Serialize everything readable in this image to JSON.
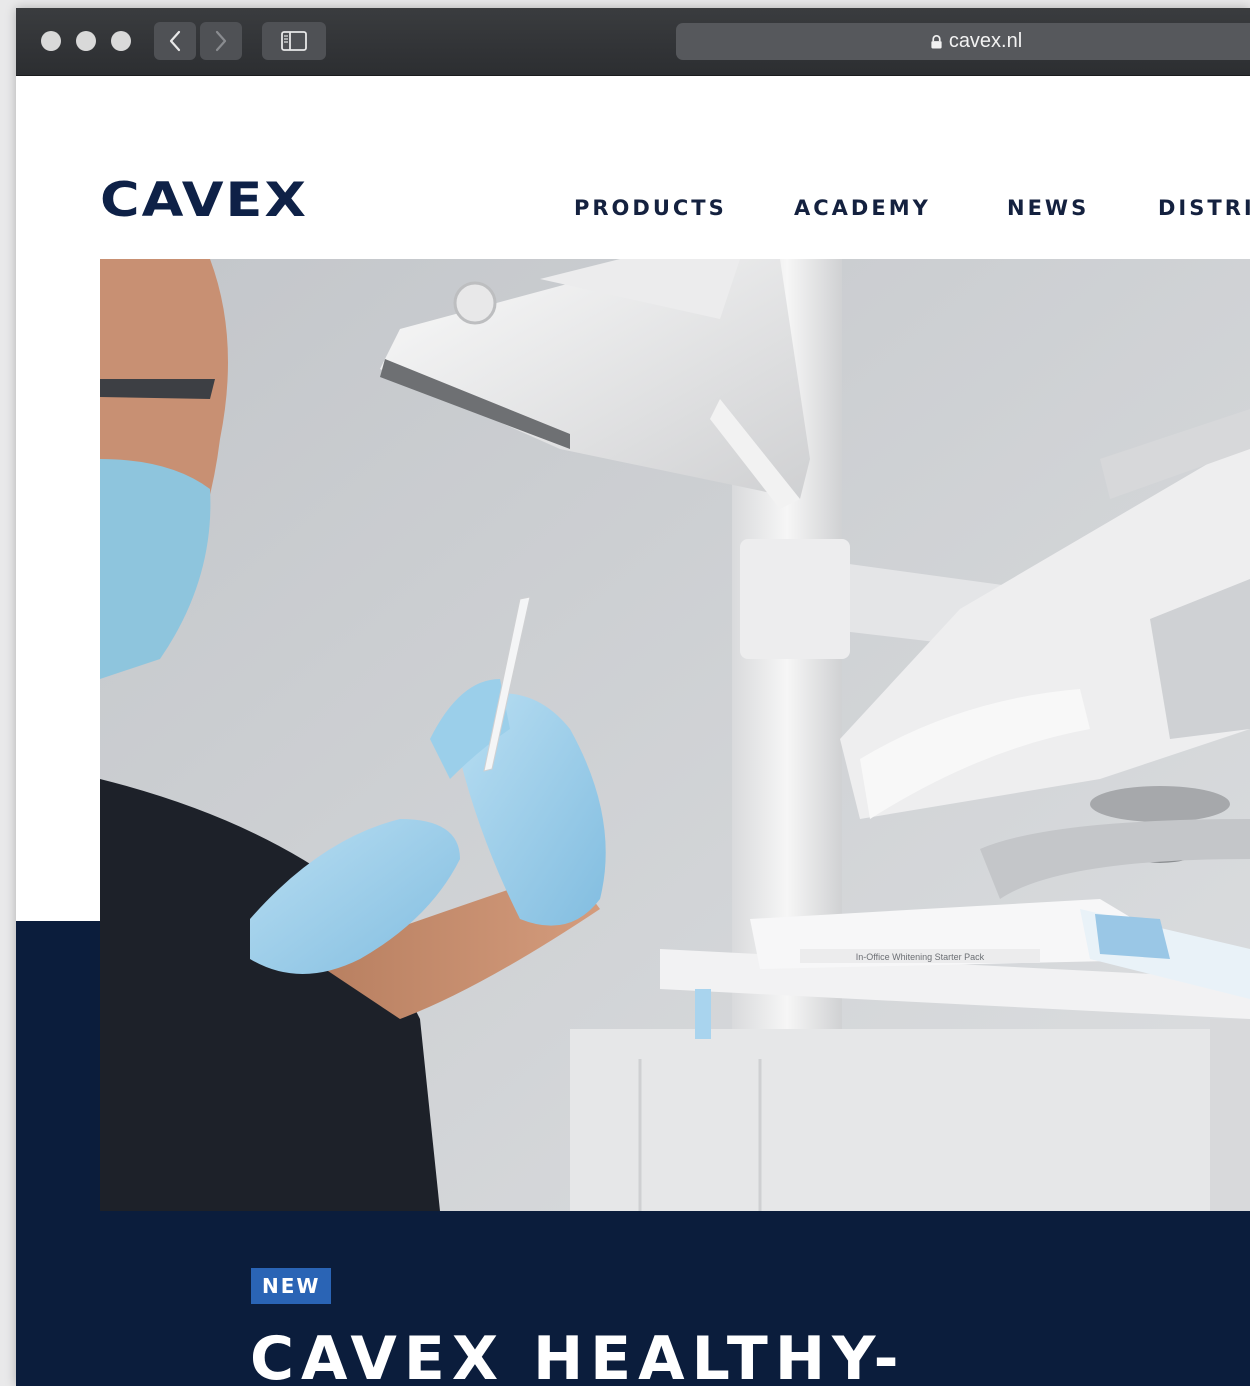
{
  "browser": {
    "url": "cavex.nl",
    "icons": [
      "close-dot",
      "minimize-dot",
      "zoom-dot",
      "back-arrow-icon",
      "forward-arrow-icon",
      "sidebar-icon",
      "lock-icon"
    ]
  },
  "site": {
    "logo_text": "CAVEX",
    "nav": [
      "PRODUCTS",
      "ACADEMY",
      "NEWS",
      "DISTRI"
    ]
  },
  "hero": {
    "badge": "NEW",
    "headline": "CAVEX HEALTHY-",
    "tray_label": "In-Office Whitening Starter Pack"
  },
  "colors": {
    "navy": "#0b1d3c",
    "brand": "#0e2147",
    "badge_blue": "#2a64b5",
    "glove_blue": "#9fd0ea"
  }
}
